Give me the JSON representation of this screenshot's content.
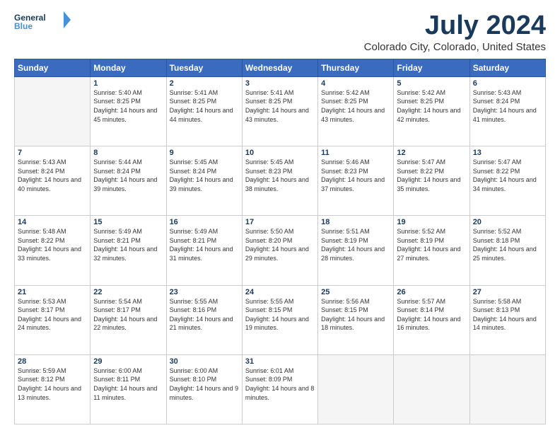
{
  "header": {
    "logo_general": "General",
    "logo_blue": "Blue",
    "month_title": "July 2024",
    "location": "Colorado City, Colorado, United States"
  },
  "days_of_week": [
    "Sunday",
    "Monday",
    "Tuesday",
    "Wednesday",
    "Thursday",
    "Friday",
    "Saturday"
  ],
  "weeks": [
    [
      {
        "day": "",
        "empty": true
      },
      {
        "day": "1",
        "sunrise": "Sunrise: 5:40 AM",
        "sunset": "Sunset: 8:25 PM",
        "daylight": "Daylight: 14 hours and 45 minutes."
      },
      {
        "day": "2",
        "sunrise": "Sunrise: 5:41 AM",
        "sunset": "Sunset: 8:25 PM",
        "daylight": "Daylight: 14 hours and 44 minutes."
      },
      {
        "day": "3",
        "sunrise": "Sunrise: 5:41 AM",
        "sunset": "Sunset: 8:25 PM",
        "daylight": "Daylight: 14 hours and 43 minutes."
      },
      {
        "day": "4",
        "sunrise": "Sunrise: 5:42 AM",
        "sunset": "Sunset: 8:25 PM",
        "daylight": "Daylight: 14 hours and 43 minutes."
      },
      {
        "day": "5",
        "sunrise": "Sunrise: 5:42 AM",
        "sunset": "Sunset: 8:25 PM",
        "daylight": "Daylight: 14 hours and 42 minutes."
      },
      {
        "day": "6",
        "sunrise": "Sunrise: 5:43 AM",
        "sunset": "Sunset: 8:24 PM",
        "daylight": "Daylight: 14 hours and 41 minutes."
      }
    ],
    [
      {
        "day": "7",
        "sunrise": "Sunrise: 5:43 AM",
        "sunset": "Sunset: 8:24 PM",
        "daylight": "Daylight: 14 hours and 40 minutes."
      },
      {
        "day": "8",
        "sunrise": "Sunrise: 5:44 AM",
        "sunset": "Sunset: 8:24 PM",
        "daylight": "Daylight: 14 hours and 39 minutes."
      },
      {
        "day": "9",
        "sunrise": "Sunrise: 5:45 AM",
        "sunset": "Sunset: 8:24 PM",
        "daylight": "Daylight: 14 hours and 39 minutes."
      },
      {
        "day": "10",
        "sunrise": "Sunrise: 5:45 AM",
        "sunset": "Sunset: 8:23 PM",
        "daylight": "Daylight: 14 hours and 38 minutes."
      },
      {
        "day": "11",
        "sunrise": "Sunrise: 5:46 AM",
        "sunset": "Sunset: 8:23 PM",
        "daylight": "Daylight: 14 hours and 37 minutes."
      },
      {
        "day": "12",
        "sunrise": "Sunrise: 5:47 AM",
        "sunset": "Sunset: 8:22 PM",
        "daylight": "Daylight: 14 hours and 35 minutes."
      },
      {
        "day": "13",
        "sunrise": "Sunrise: 5:47 AM",
        "sunset": "Sunset: 8:22 PM",
        "daylight": "Daylight: 14 hours and 34 minutes."
      }
    ],
    [
      {
        "day": "14",
        "sunrise": "Sunrise: 5:48 AM",
        "sunset": "Sunset: 8:22 PM",
        "daylight": "Daylight: 14 hours and 33 minutes."
      },
      {
        "day": "15",
        "sunrise": "Sunrise: 5:49 AM",
        "sunset": "Sunset: 8:21 PM",
        "daylight": "Daylight: 14 hours and 32 minutes."
      },
      {
        "day": "16",
        "sunrise": "Sunrise: 5:49 AM",
        "sunset": "Sunset: 8:21 PM",
        "daylight": "Daylight: 14 hours and 31 minutes."
      },
      {
        "day": "17",
        "sunrise": "Sunrise: 5:50 AM",
        "sunset": "Sunset: 8:20 PM",
        "daylight": "Daylight: 14 hours and 29 minutes."
      },
      {
        "day": "18",
        "sunrise": "Sunrise: 5:51 AM",
        "sunset": "Sunset: 8:19 PM",
        "daylight": "Daylight: 14 hours and 28 minutes."
      },
      {
        "day": "19",
        "sunrise": "Sunrise: 5:52 AM",
        "sunset": "Sunset: 8:19 PM",
        "daylight": "Daylight: 14 hours and 27 minutes."
      },
      {
        "day": "20",
        "sunrise": "Sunrise: 5:52 AM",
        "sunset": "Sunset: 8:18 PM",
        "daylight": "Daylight: 14 hours and 25 minutes."
      }
    ],
    [
      {
        "day": "21",
        "sunrise": "Sunrise: 5:53 AM",
        "sunset": "Sunset: 8:17 PM",
        "daylight": "Daylight: 14 hours and 24 minutes."
      },
      {
        "day": "22",
        "sunrise": "Sunrise: 5:54 AM",
        "sunset": "Sunset: 8:17 PM",
        "daylight": "Daylight: 14 hours and 22 minutes."
      },
      {
        "day": "23",
        "sunrise": "Sunrise: 5:55 AM",
        "sunset": "Sunset: 8:16 PM",
        "daylight": "Daylight: 14 hours and 21 minutes."
      },
      {
        "day": "24",
        "sunrise": "Sunrise: 5:55 AM",
        "sunset": "Sunset: 8:15 PM",
        "daylight": "Daylight: 14 hours and 19 minutes."
      },
      {
        "day": "25",
        "sunrise": "Sunrise: 5:56 AM",
        "sunset": "Sunset: 8:15 PM",
        "daylight": "Daylight: 14 hours and 18 minutes."
      },
      {
        "day": "26",
        "sunrise": "Sunrise: 5:57 AM",
        "sunset": "Sunset: 8:14 PM",
        "daylight": "Daylight: 14 hours and 16 minutes."
      },
      {
        "day": "27",
        "sunrise": "Sunrise: 5:58 AM",
        "sunset": "Sunset: 8:13 PM",
        "daylight": "Daylight: 14 hours and 14 minutes."
      }
    ],
    [
      {
        "day": "28",
        "sunrise": "Sunrise: 5:59 AM",
        "sunset": "Sunset: 8:12 PM",
        "daylight": "Daylight: 14 hours and 13 minutes."
      },
      {
        "day": "29",
        "sunrise": "Sunrise: 6:00 AM",
        "sunset": "Sunset: 8:11 PM",
        "daylight": "Daylight: 14 hours and 11 minutes."
      },
      {
        "day": "30",
        "sunrise": "Sunrise: 6:00 AM",
        "sunset": "Sunset: 8:10 PM",
        "daylight": "Daylight: 14 hours and 9 minutes."
      },
      {
        "day": "31",
        "sunrise": "Sunrise: 6:01 AM",
        "sunset": "Sunset: 8:09 PM",
        "daylight": "Daylight: 14 hours and 8 minutes."
      },
      {
        "day": "",
        "empty": true
      },
      {
        "day": "",
        "empty": true
      },
      {
        "day": "",
        "empty": true
      }
    ]
  ]
}
